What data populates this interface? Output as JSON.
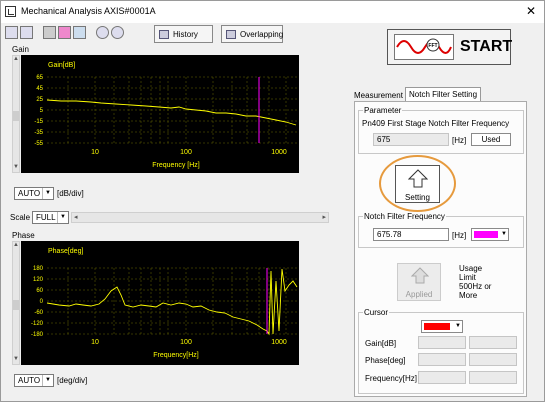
{
  "window": {
    "title": "Mechanical Analysis AXIS#0001A",
    "close_glyph": "✕"
  },
  "toolbar": {
    "icons": [
      "save-icon",
      "print-icon",
      "chart-icon",
      "chart-color-icon",
      "marker-icon",
      "zoom-in-icon",
      "zoom-out-icon"
    ],
    "history_label": "History",
    "overlapping_label": "Overlapping"
  },
  "gain_panel": {
    "title": "Gain",
    "plot_title": "Gain[dB]",
    "y_ticks": [
      "65",
      "45",
      "25",
      "5",
      "-15",
      "-35",
      "-55"
    ],
    "x_ticks": [
      "10",
      "100",
      "1000"
    ],
    "x_label": "Frequency [Hz]",
    "scale_select": "AUTO",
    "scale_unit": "[dB/div]"
  },
  "scale_row": {
    "label": "Scale",
    "value": "FULL"
  },
  "phase_panel": {
    "title": "Phase",
    "plot_title": "Phase[deg]",
    "y_ticks": [
      "180",
      "120",
      "60",
      "0",
      "-60",
      "-120",
      "-180"
    ],
    "x_ticks": [
      "10",
      "100",
      "1000"
    ],
    "x_label": "Frequency[Hz]",
    "scale_select": "AUTO",
    "scale_unit": "[deg/div]"
  },
  "start_button": {
    "label": "START",
    "badge": "FFT"
  },
  "tabs": {
    "measurement": "Measurement",
    "notch": "Notch Filter Setting"
  },
  "parameter_group": {
    "title": "Parameter",
    "desc": "Pn409   First Stage Notch Filter Frequency",
    "value": "675",
    "unit": "[Hz]",
    "used_label": "Used"
  },
  "setting_button": {
    "label": "Setting"
  },
  "notch_group": {
    "title": "Notch Filter Frequency",
    "value": "675.78",
    "unit": "[Hz]",
    "color": "#ff00ff"
  },
  "applied_button": {
    "label": "Applied"
  },
  "usage_note": [
    "Usage",
    "Limit",
    "500Hz or",
    "More"
  ],
  "cursor_group": {
    "title": "Cursor",
    "color": "#ff0000",
    "rows": [
      "Gain[dB]",
      "Phase[deg]",
      "Frequency[Hz]"
    ]
  },
  "colors": {
    "trace": "#ffff00",
    "marker": "#ff00ff",
    "grid": "#6b6b00"
  }
}
